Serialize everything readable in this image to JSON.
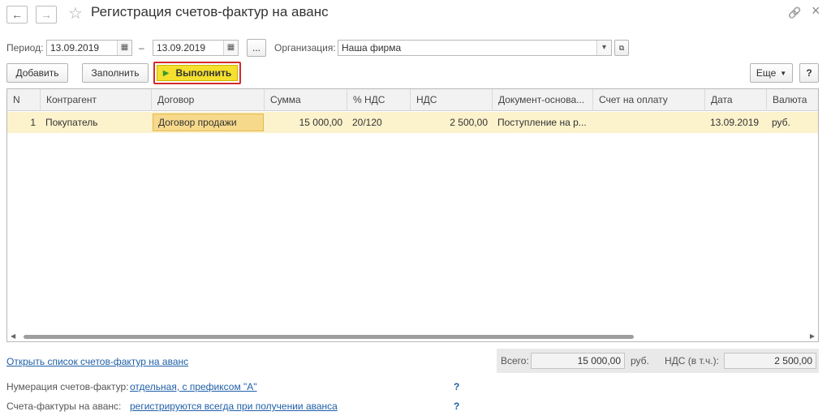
{
  "window": {
    "title": "Регистрация счетов-фактур на аванс",
    "back_icon": "←",
    "forward_icon": "→",
    "star_icon": "☆",
    "link_icon": "🔗",
    "close_icon": "×"
  },
  "filters": {
    "period_label": "Период:",
    "date_from": "13.09.2019",
    "dash": "–",
    "date_to": "13.09.2019",
    "ellipsis": "...",
    "org_label": "Организация:",
    "org_value": "Наша фирма"
  },
  "toolbar": {
    "add": "Добавить",
    "fill": "Заполнить",
    "run": "Выполнить",
    "more": "Еще",
    "help": "?"
  },
  "table": {
    "columns": [
      "N",
      "Контрагент",
      "Договор",
      "Сумма",
      "% НДС",
      "НДС",
      "Документ-основа...",
      "Счет на оплату",
      "Дата",
      "Валюта"
    ],
    "rows": [
      {
        "n": "1",
        "counterparty": "Покупатель",
        "contract": "Договор продажи",
        "sum": "15 000,00",
        "vat_rate": "20/120",
        "vat": "2 500,00",
        "base_doc": "Поступление на р...",
        "invoice": "",
        "date": "13.09.2019",
        "currency": "руб."
      }
    ]
  },
  "footer": {
    "open_list_link": "Открыть список счетов-фактур на аванс",
    "total_label": "Всего:",
    "total_value": "15 000,00",
    "currency": "руб.",
    "vat_label": "НДС (в т.ч.):",
    "vat_value": "2 500,00",
    "numbering_label": "Нумерация счетов-фактур:",
    "numbering_link": "отдельная, с префиксом \"А\"",
    "invoices_label": "Счета-фактуры на аванс:",
    "invoices_link": "регистрируются всегда при получении аванса",
    "help_mark": "?"
  },
  "colors": {
    "run_button": "#f5e02e",
    "run_outline": "#d32b2b",
    "selected_row": "#fcf2cc",
    "link": "#1f5fa8"
  }
}
